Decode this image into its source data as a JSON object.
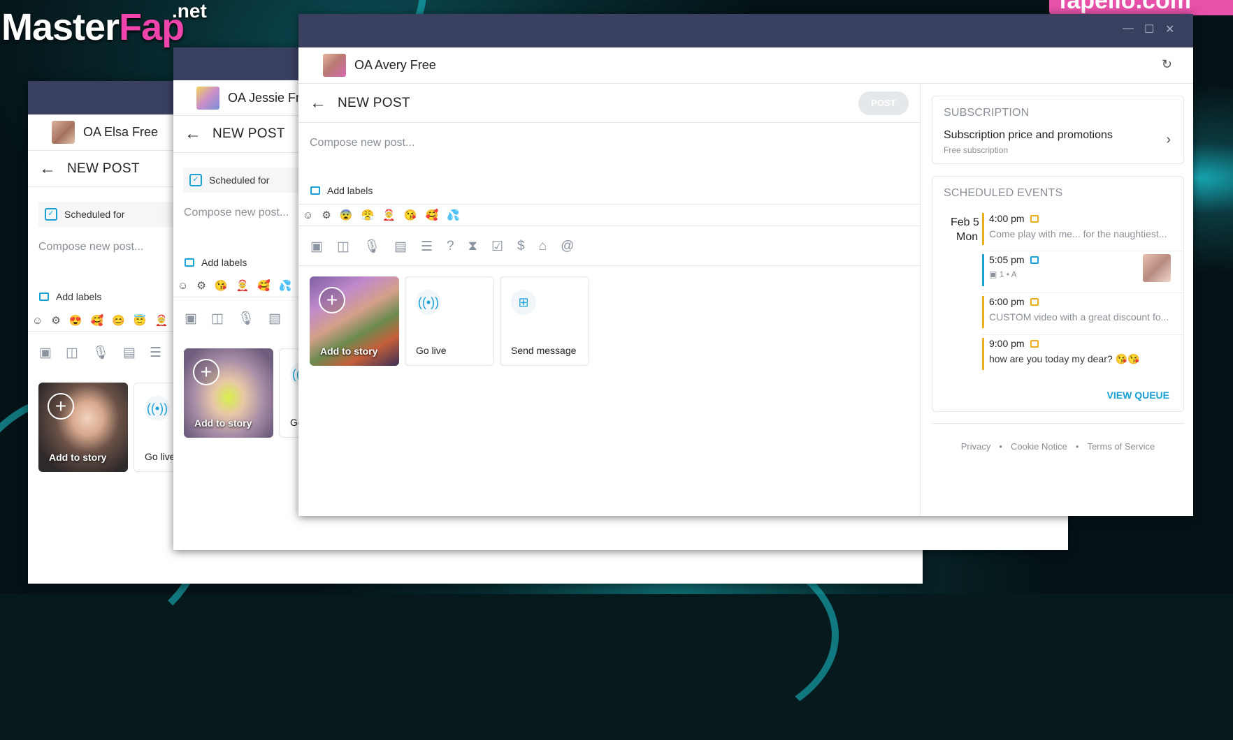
{
  "watermark": {
    "brand_left": "Master",
    "brand_right": "Fap",
    "brand_suffix": ".net",
    "corner_text": "fapello.com"
  },
  "window_elsa": {
    "account_name": "OA Elsa Free",
    "new_post_title": "NEW POST",
    "scheduled_label": "Scheduled for",
    "compose_placeholder": "Compose new post...",
    "add_labels": "Add labels",
    "emojis": [
      "😍",
      "🥰",
      "😊",
      "😇",
      "🤶"
    ],
    "tiles": {
      "story": "Add to story",
      "live": "Go live"
    }
  },
  "window_jessie": {
    "account_name": "OA Jessie Fr",
    "new_post_title": "NEW POST",
    "scheduled_label": "Scheduled for",
    "compose_placeholder": "Compose new post...",
    "add_labels": "Add labels",
    "emojis": [
      "😘",
      "🤶",
      "🥰",
      "💦"
    ],
    "tiles": {
      "story": "Add to story",
      "live": "Go"
    }
  },
  "window_avery": {
    "account_name": "OA Avery Free",
    "new_post_title": "NEW POST",
    "post_button": "POST",
    "compose_placeholder": "Compose new post...",
    "add_labels": "Add labels",
    "emojis": [
      "😨",
      "😤",
      "🤶",
      "😘",
      "🥰",
      "💦"
    ],
    "tiles": {
      "story": "Add to story",
      "live": "Go live",
      "message": "Send message"
    },
    "subscription": {
      "title": "SUBSCRIPTION",
      "item_title": "Subscription price and promotions",
      "item_sub": "Free subscription"
    },
    "scheduled": {
      "title": "SCHEDULED EVENTS",
      "date": "Feb 5",
      "weekday": "Mon",
      "events": [
        {
          "time": "4:00 pm",
          "text": "Come play with me... for the naughtiest...",
          "color": "#f0ad1e"
        },
        {
          "time": "5:05 pm",
          "text": "1",
          "color": "#1aa1d6"
        },
        {
          "time": "6:00 pm",
          "text": "CUSTOM video with a great discount fo...",
          "color": "#f0ad1e"
        },
        {
          "time": "9:00 pm",
          "text": "how are you today my dear? 😘😘",
          "color": "#f0ad1e"
        }
      ],
      "view_queue": "VIEW QUEUE"
    },
    "footer": {
      "privacy": "Privacy",
      "cookie": "Cookie Notice",
      "terms": "Terms of Service"
    }
  },
  "colors": {
    "accent": "#1aa1d6",
    "titlebar": "#3a4060",
    "event_orange": "#f0ad1e",
    "brand_pink": "#ee45ad"
  }
}
